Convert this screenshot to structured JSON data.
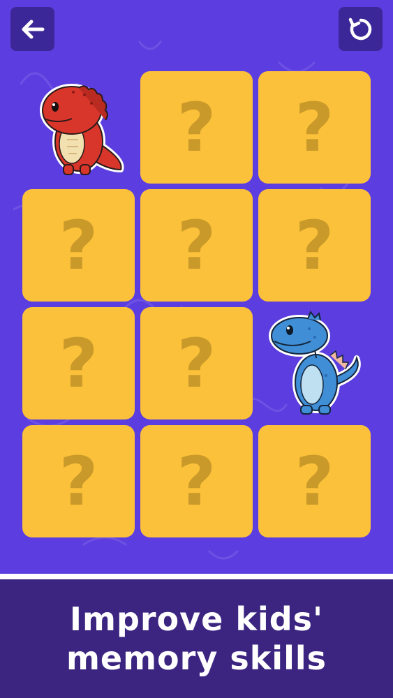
{
  "toolbar": {
    "back_icon": "arrow-left-icon",
    "restart_icon": "restart-icon",
    "button_color": "#3b2797"
  },
  "board": {
    "rows": 4,
    "cols": 3,
    "card_color": "#fcc13a",
    "question_color": "#c99a2a",
    "cards": [
      {
        "state": "revealed",
        "symbol": "red-dinosaur",
        "label": ""
      },
      {
        "state": "hidden",
        "label": "?"
      },
      {
        "state": "hidden",
        "label": "?"
      },
      {
        "state": "hidden",
        "label": "?"
      },
      {
        "state": "hidden",
        "label": "?"
      },
      {
        "state": "hidden",
        "label": "?"
      },
      {
        "state": "hidden",
        "label": "?"
      },
      {
        "state": "hidden",
        "label": "?"
      },
      {
        "state": "revealed",
        "symbol": "blue-dinosaur",
        "label": ""
      },
      {
        "state": "hidden",
        "label": "?"
      },
      {
        "state": "hidden",
        "label": "?"
      },
      {
        "state": "hidden",
        "label": "?"
      }
    ]
  },
  "banner": {
    "line1": "Improve kids'",
    "line2": "memory skills",
    "color": "#3b2580"
  },
  "theme": {
    "background": "#5c3ee0"
  }
}
